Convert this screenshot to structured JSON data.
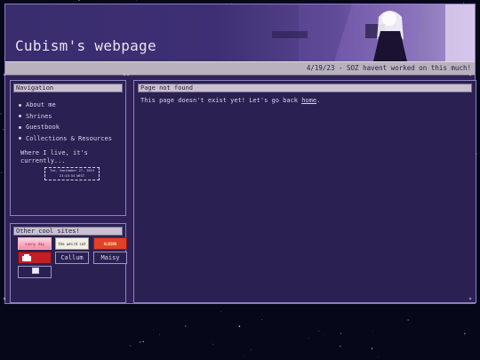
{
  "site": {
    "title": "Cubism's webpage",
    "marquee": "4/19/23 - SOZ havent worked on this much!"
  },
  "nav": {
    "header": "Navigation",
    "items": [
      {
        "label": "About me"
      },
      {
        "label": "Shrines"
      },
      {
        "label": "Guestbook"
      },
      {
        "label": "Collections & Resources"
      }
    ],
    "live_text": "Where I live, it's currently...",
    "clock": "Tue, September 27, 2024 23:45:54 WEST"
  },
  "cool_sites": {
    "header": "Other cool sites!",
    "buttons": [
      {
        "text": "sunny day"
      },
      {
        "text": "the weird cat"
      },
      {
        "text": "ALBINO"
      },
      {
        "text": ""
      },
      {
        "text": "Callum"
      },
      {
        "text": "Maisy"
      }
    ]
  },
  "main": {
    "header": "Page not found",
    "text_before": "This page doesn't exist yet! Let's go back ",
    "link": "home",
    "text_after": "."
  },
  "colors": {
    "background": "#07071a",
    "panel": "#2a2152",
    "header_bar": "#c9c1cf",
    "text": "#d8d2ee"
  }
}
